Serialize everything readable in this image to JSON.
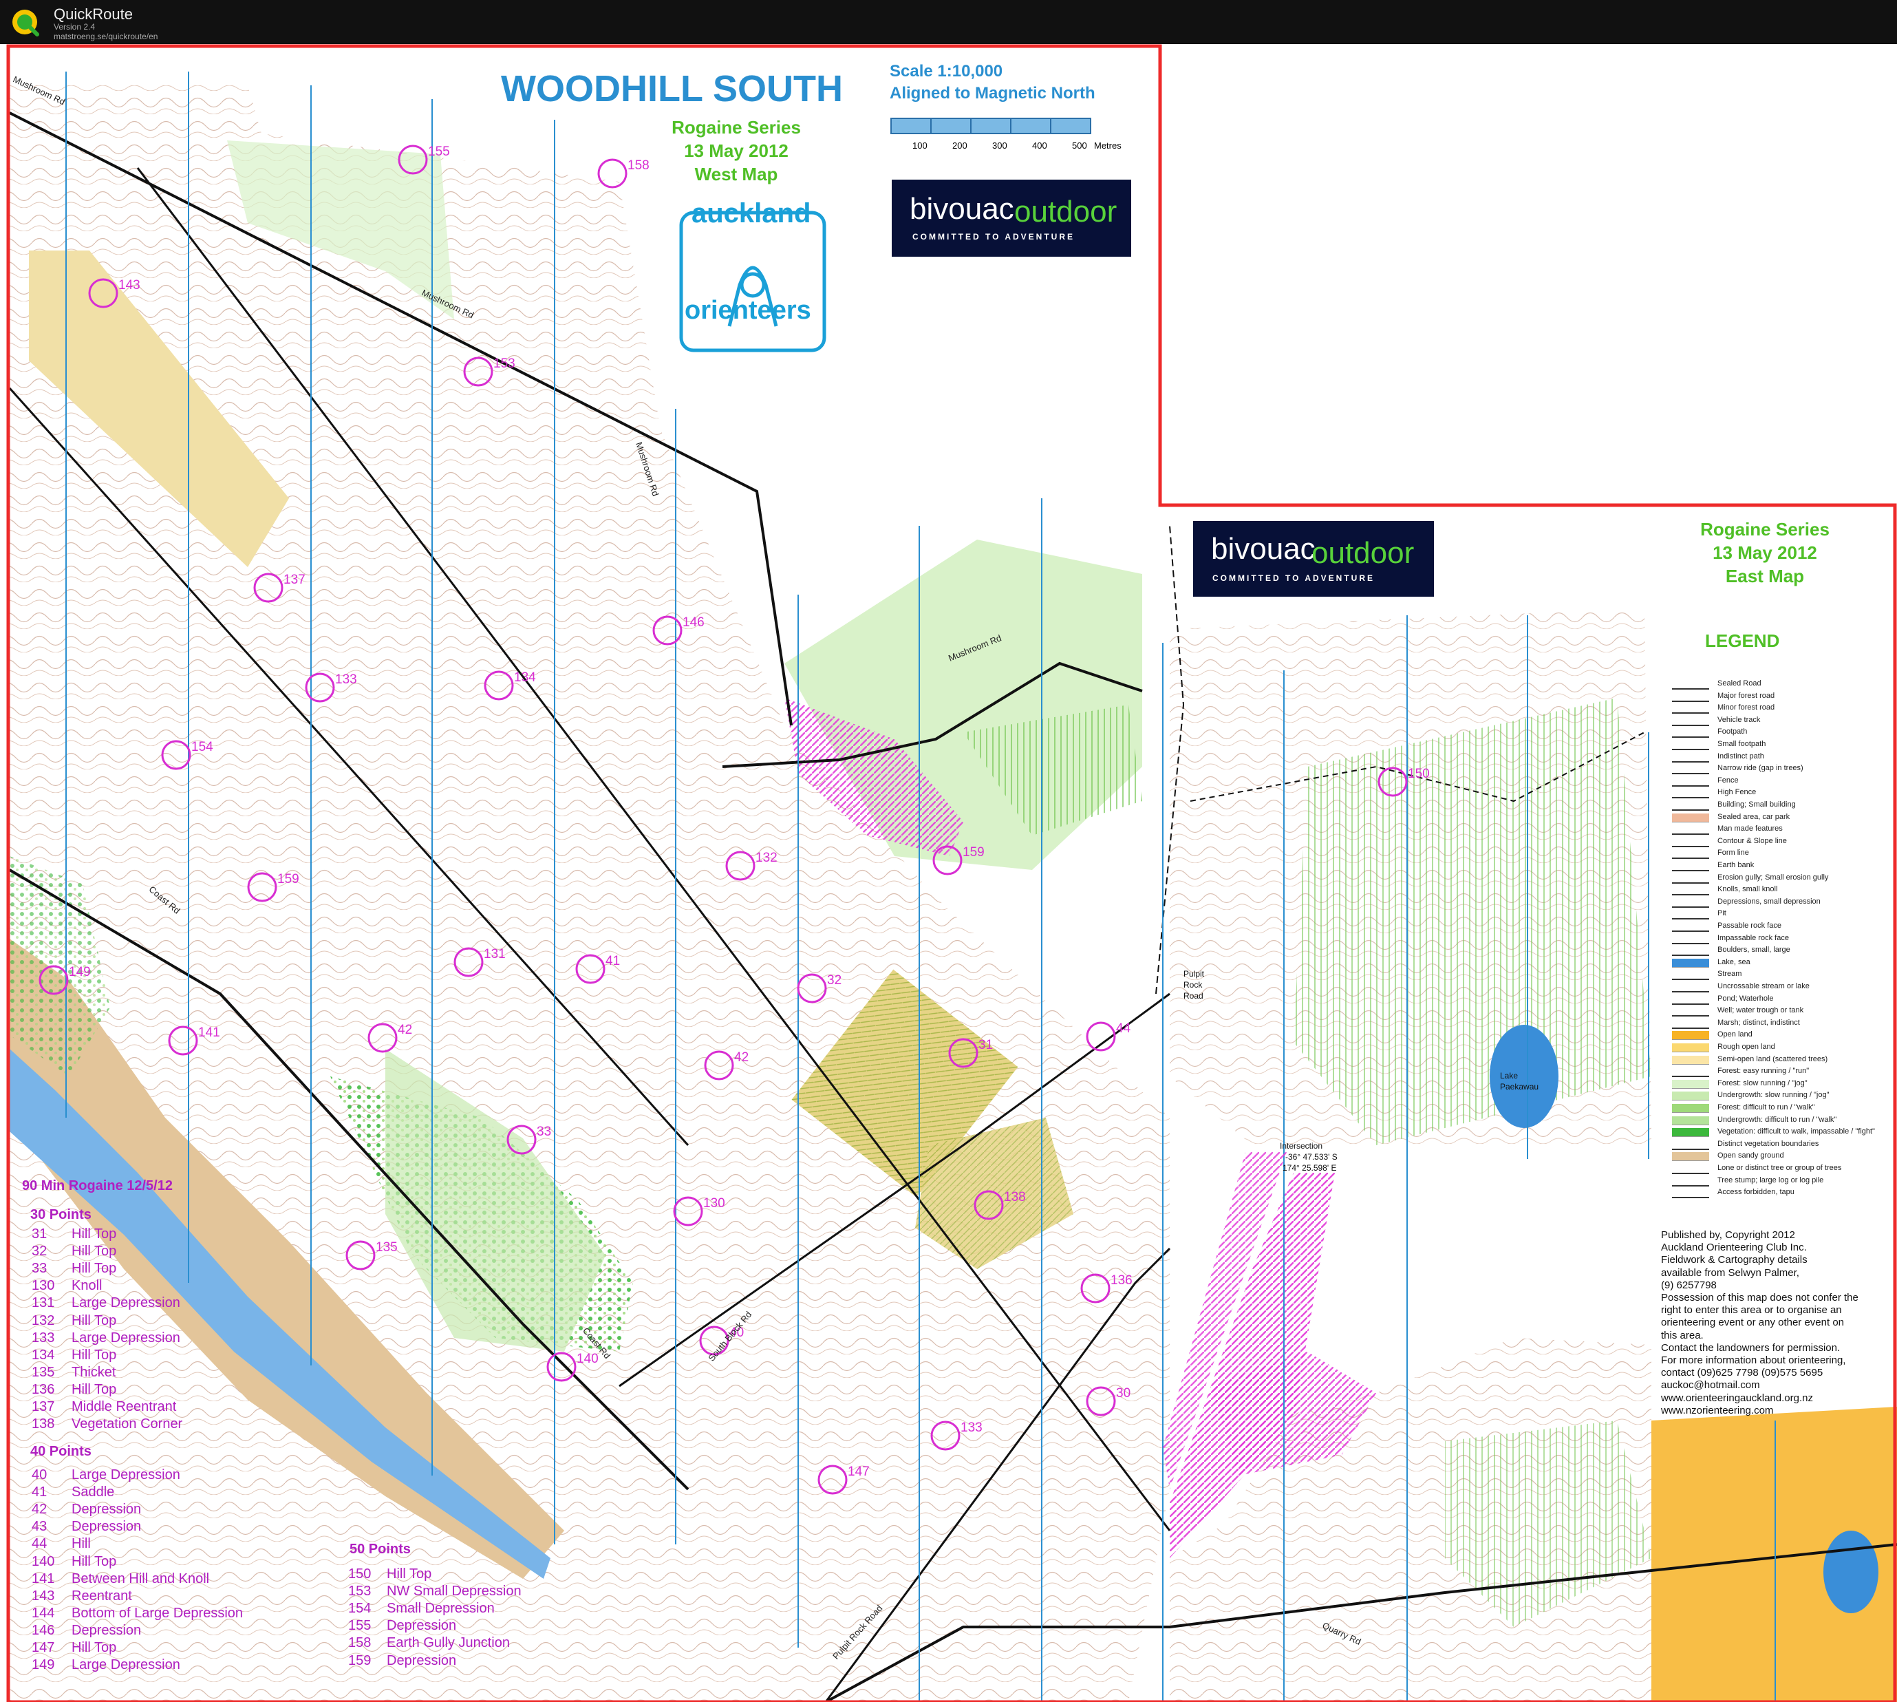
{
  "app": {
    "name": "QuickRoute",
    "version": "Version 2.4",
    "url": "matstroeng.se/quickroute/en"
  },
  "map": {
    "title": "WOODHILL SOUTH",
    "west_subtitle": [
      "Rogaine Series",
      "13 May 2012",
      "West Map"
    ],
    "east_subtitle": [
      "Rogaine Series",
      "13 May 2012",
      "East Map"
    ],
    "scale_line1": "Scale 1:10,000",
    "scale_line2": "Aligned to Magnetic North",
    "scale_ticks": [
      "100",
      "200",
      "300",
      "400",
      "500"
    ],
    "scale_unit": "Metres",
    "club_logo_text": [
      "auckland",
      "orienteers"
    ],
    "sponsor": {
      "word1": "bivouac",
      "word2": "outdoor",
      "tagline": "COMMITTED TO ADVENTURE"
    },
    "legend_title": "LEGEND",
    "legend_items": [
      "Sealed Road",
      "Major forest road",
      "Minor forest road",
      "Vehicle track",
      "Footpath",
      "Small footpath",
      "Indistinct path",
      "Narrow ride (gap in trees)",
      "Fence",
      "High Fence",
      "Building; Small building",
      "Sealed area, car park",
      "Man made features",
      "Contour & Slope line",
      "Form line",
      "Earth bank",
      "Erosion gully; Small erosion gully",
      "Knolls, small knoll",
      "Depressions, small depression",
      "Pit",
      "Passable rock face",
      "Impassable rock face",
      "Boulders, small, large",
      "Lake, sea",
      "Stream",
      "Uncrossable stream or lake",
      "Pond; Waterhole",
      "Well; water trough or tank",
      "Marsh; distinct, indistinct",
      "Open land",
      "Rough open land",
      "Semi-open land (scattered trees)",
      "Forest: easy running / \"run\"",
      "Forest: slow running / \"jog\"",
      "Undergrowth: slow running / \"jog\"",
      "Forest: difficult to run / \"walk\"",
      "Undergrowth: difficult to run / \"walk\"",
      "Vegetation: difficult to walk, impassable / \"fight\"",
      "Distinct vegetation boundaries",
      "Open sandy ground",
      "Lone or distinct tree or group of trees",
      "Tree stump; large log or log pile",
      "Access forbidden, tapu"
    ],
    "legend_colors": [
      "#ffffff",
      "#ffffff",
      "#ffffff",
      "#ffffff",
      "#ffffff",
      "#ffffff",
      "#ffffff",
      "#ffffff",
      "#ffffff",
      "#ffffff",
      "#ffffff",
      "#f0b89a",
      "#ffffff",
      "#ffffff",
      "#ffffff",
      "#ffffff",
      "#ffffff",
      "#ffffff",
      "#ffffff",
      "#ffffff",
      "#ffffff",
      "#ffffff",
      "#ffffff",
      "#3a8ed8",
      "#ffffff",
      "#ffffff",
      "#ffffff",
      "#ffffff",
      "#ffffff",
      "#f7b326",
      "#fbd870",
      "#fbe5a6",
      "#ffffff",
      "#d9f2c9",
      "#c8eab0",
      "#9ed97a",
      "#b4e39a",
      "#3cb83c",
      "#ffffff",
      "#e3c59a",
      "#ffffff",
      "#ffffff",
      "#ffffff"
    ],
    "publisher_text": [
      "Published by, Copyright 2012",
      "Auckland Orienteering Club Inc.",
      "Fieldwork & Cartography details",
      "available from Selwyn Palmer,",
      "(9) 6257798",
      "Possession of this map does not confer the",
      "right to enter this area or to organise an",
      "orienteering event or any other event on",
      "this area.",
      "Contact the landowners for permission.",
      "For more information about orienteering,",
      "contact (09)625 7798  (09)575 5695",
      "auckoc@hotmail.com",
      "www.orienteeringauckland.org.nz",
      "www.nzorienteering.com"
    ],
    "place_labels": {
      "lake": [
        "Lake",
        "Paekawau"
      ],
      "pulpit": [
        "Pulpit",
        "Rock",
        "Road"
      ],
      "intersection": [
        "Intersection",
        "-36° 47.533' S",
        "174° 25.598' E"
      ]
    },
    "road_labels": [
      "Mushroom Rd",
      "Mushroom Rd",
      "Mushroom Rd",
      "Mushroom Rd",
      "Coast Rd",
      "Coast Rd",
      "South Block Rd",
      "Pulpit Rock Road",
      "Quarry Rd"
    ],
    "controls": [
      "158",
      "155",
      "143",
      "153",
      "146",
      "137",
      "134",
      "133",
      "154",
      "150",
      "132",
      "159",
      "131",
      "41",
      "32",
      "44",
      "149",
      "141",
      "42",
      "31",
      "33",
      "130",
      "138",
      "136",
      "135",
      "140",
      "40",
      "147",
      "133",
      "30",
      "159",
      "42"
    ]
  },
  "rogaine": {
    "title": "90 Min Rogaine 12/5/12",
    "groups": [
      {
        "heading": "30 Points",
        "items": [
          [
            "31",
            "Hill Top"
          ],
          [
            "32",
            "Hill Top"
          ],
          [
            "33",
            "Hill Top"
          ],
          [
            "130",
            "Knoll"
          ],
          [
            "131",
            "Large Depression"
          ],
          [
            "132",
            "Hill Top"
          ],
          [
            "133",
            "Large Depression"
          ],
          [
            "134",
            "Hill Top"
          ],
          [
            "135",
            "Thicket"
          ],
          [
            "136",
            "Hill Top"
          ],
          [
            "137",
            "Middle Reentrant"
          ],
          [
            "138",
            "Vegetation Corner"
          ]
        ]
      },
      {
        "heading": "40 Points",
        "items": [
          [
            "40",
            "Large Depression"
          ],
          [
            "41",
            "Saddle"
          ],
          [
            "42",
            "Depression"
          ],
          [
            "43",
            "Depression"
          ],
          [
            "44",
            "Hill"
          ],
          [
            "140",
            "Hill Top"
          ],
          [
            "141",
            "Between Hill and Knoll"
          ],
          [
            "143",
            "Reentrant"
          ],
          [
            "144",
            "Bottom of Large Depression"
          ],
          [
            "146",
            "Depression"
          ],
          [
            "147",
            "Hill Top"
          ],
          [
            "149",
            "Large Depression"
          ]
        ]
      },
      {
        "heading": "50 Points",
        "items": [
          [
            "150",
            "Hill Top"
          ],
          [
            "153",
            "NW Small Depression"
          ],
          [
            "154",
            "Small Depression"
          ],
          [
            "155",
            "Depression"
          ],
          [
            "158",
            "Earth Gully Junction"
          ],
          [
            "159",
            "Depression"
          ]
        ]
      }
    ]
  }
}
